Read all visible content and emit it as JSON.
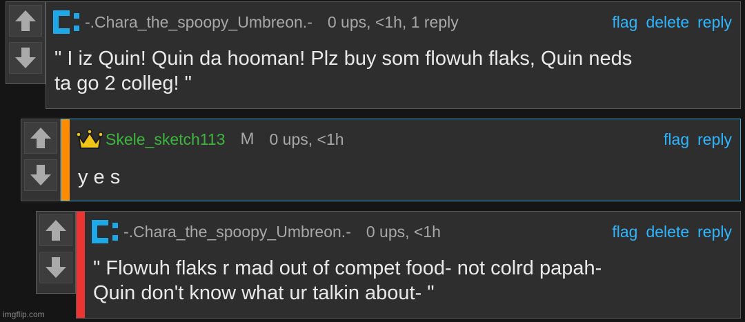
{
  "comments": [
    {
      "username": "-.Chara_the_spoopy_Umbreon.-",
      "meta": "0 ups, <1h, 1 reply",
      "text_line1": "\" I iz Quin! Quin da hooman! Plz buy som flowuh flaks, Quin neds",
      "text_line2": "ta go 2 colleg! \"",
      "actions": {
        "flag": "flag",
        "delete": "delete",
        "reply": "reply"
      },
      "badge_icon": "blue-bracket-badge-icon"
    },
    {
      "username": "Skele_sketch113",
      "mod_label": "M",
      "meta": "0 ups, <1h",
      "text_line1": "y e s",
      "actions": {
        "flag": "flag",
        "reply": "reply"
      },
      "badge_icon": "crown-icon",
      "stripe_color": "#ff8c00",
      "username_color": "#3db53d"
    },
    {
      "username": "-.Chara_the_spoopy_Umbreon.-",
      "meta": "0 ups, <1h",
      "text_line1": "\" Flowuh flaks r mad out of compet food- not colrd papah-",
      "text_line2": "Quin don't know what ur talkin about- \"",
      "actions": {
        "flag": "flag",
        "delete": "delete",
        "reply": "reply"
      },
      "badge_icon": "blue-bracket-badge-icon",
      "stripe_color": "#ee3333"
    }
  ],
  "watermark": "imgflip.com",
  "colors": {
    "link": "#2fb5ff",
    "badge_blue": "#1fa8e8",
    "highlight_border": "#3fa9d6"
  }
}
